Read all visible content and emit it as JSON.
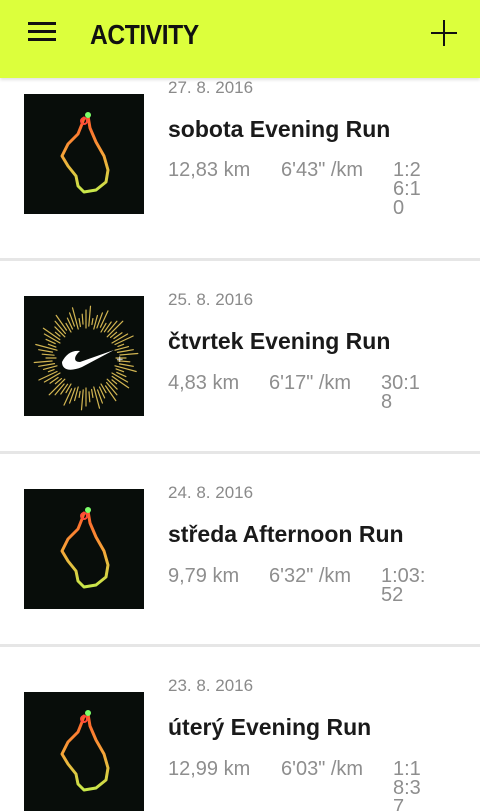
{
  "header": {
    "title": "ACTIVITY"
  },
  "activities": [
    {
      "date": "27. 8. 2016",
      "name": "sobota Evening Run",
      "distance": "12,83 km",
      "pace": "6'43\" /km",
      "duration": "1:26:10"
    },
    {
      "date": "25. 8. 2016",
      "name": "čtvrtek Evening Run",
      "distance": "4,83 km",
      "pace": "6'17\" /km",
      "duration": "30:18"
    },
    {
      "date": "24. 8. 2016",
      "name": "středa Afternoon Run",
      "distance": "9,79 km",
      "pace": "6'32\" /km",
      "duration": "1:03:52"
    },
    {
      "date": "23. 8. 2016",
      "name": "úterý Evening Run",
      "distance": "12,99 km",
      "pace": "6'03\" /km",
      "duration": "1:18:37"
    }
  ],
  "colors": {
    "header_bg": "#dcff3c",
    "thumb_bg": "#080d0a",
    "route_start": "#c8e84a",
    "route_end": "#ff5a2a",
    "start_dot": "#7dff6a",
    "end_dot": "#ff4a3a",
    "burst": "#e8c85a"
  },
  "icons": {
    "menu": "hamburger-menu-icon",
    "add": "plus-icon",
    "brand": "nike-swoosh-icon"
  }
}
